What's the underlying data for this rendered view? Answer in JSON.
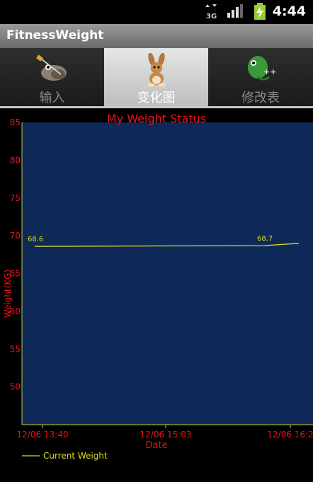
{
  "status_bar": {
    "network": "3G",
    "time": "4:44"
  },
  "app": {
    "title": "FitnessWeight"
  },
  "tabs": [
    {
      "label": "输入",
      "icon": "gimp-icon",
      "active": false
    },
    {
      "label": "变化图",
      "icon": "rabbit-icon",
      "active": true
    },
    {
      "label": "修改表",
      "icon": "chameleon-cpp-icon",
      "active": false
    }
  ],
  "colors": {
    "plot_background": "#0e2857",
    "line": "#dede22",
    "label_red": "#e8121a",
    "axis": "#c8c832"
  },
  "chart_data": {
    "type": "line",
    "title": "My Weight Status",
    "xlabel": "Date",
    "ylabel": "Weight(KG)",
    "ylim": [
      45,
      85
    ],
    "y_ticks": [
      "85",
      "80",
      "75",
      "70",
      "65",
      "60",
      "55",
      "50"
    ],
    "x_ticks": [
      "12/06 13:40",
      "12/06 15:03",
      "12/06 16:2"
    ],
    "series": [
      {
        "name": "Current Weight",
        "x": [
          "12/06 13:40",
          "12/06 16:05",
          "12/06 16:20"
        ],
        "values": [
          68.6,
          68.7,
          69.0
        ],
        "point_labels": [
          "68.6",
          "68.7",
          ""
        ]
      }
    ],
    "legend": "bottom-left",
    "grid": false
  }
}
